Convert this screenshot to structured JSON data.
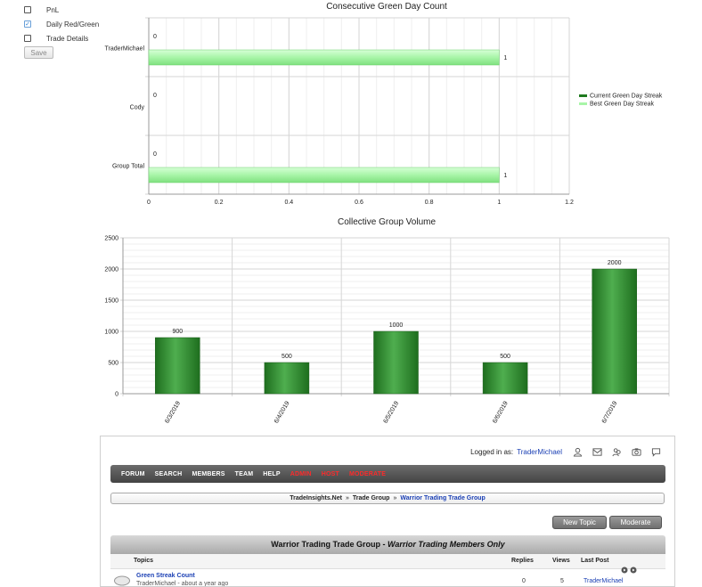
{
  "share_options": {
    "items": [
      {
        "label": "PnL",
        "checked": false
      },
      {
        "label": "Daily Red/Green",
        "checked": true
      },
      {
        "label": "Trade Details",
        "checked": false
      }
    ],
    "save_label": "Save"
  },
  "chart_data": [
    {
      "type": "bar",
      "orientation": "horizontal",
      "title": "Consecutive Green Day Count",
      "categories": [
        "TraderMichael",
        "Cody",
        "Group Total"
      ],
      "series": [
        {
          "name": "Current Green Day Streak",
          "values": [
            0,
            0,
            0
          ],
          "color": "#1f7a1f"
        },
        {
          "name": "Best Green Day Streak",
          "values": [
            1,
            0,
            1
          ],
          "color": "#a8f5a8"
        }
      ],
      "current_labels": [
        "0",
        "0",
        "0"
      ],
      "best_labels": [
        "1",
        "",
        "1"
      ],
      "xlim": [
        0,
        1.2
      ],
      "xticks": [
        "0",
        "0.2",
        "0.4",
        "0.6",
        "0.8",
        "1",
        "1.2"
      ],
      "grid": true,
      "legend": "right"
    },
    {
      "type": "bar",
      "title": "Collective Group Volume",
      "categories": [
        "6/3/2019",
        "6/4/2019",
        "6/5/2019",
        "6/6/2019",
        "6/7/2019"
      ],
      "values": [
        900,
        500,
        1000,
        500,
        2000
      ],
      "value_labels": [
        "900",
        "500",
        "1000",
        "500",
        "2000"
      ],
      "ylim": [
        0,
        2500
      ],
      "yticks": [
        "0",
        "500",
        "1000",
        "1500",
        "2000",
        "2500"
      ],
      "color": "#2e8b2e",
      "grid": true
    }
  ],
  "forum": {
    "logged_in_label": "Logged in as:",
    "username": "TraderMichael",
    "top_icons": [
      "user-icon",
      "mail-icon",
      "users-icon",
      "camera-icon",
      "chat-icon"
    ],
    "nav": [
      {
        "label": "FORUM",
        "highlight": false
      },
      {
        "label": "SEARCH",
        "highlight": false
      },
      {
        "label": "MEMBERS",
        "highlight": false
      },
      {
        "label": "TEAM",
        "highlight": false
      },
      {
        "label": "HELP",
        "highlight": false
      },
      {
        "label": "ADMIN",
        "highlight": true
      },
      {
        "label": "HOST",
        "highlight": true
      },
      {
        "label": "MODERATE",
        "highlight": true
      }
    ],
    "breadcrumb": [
      "TradeInsights.Net",
      "Trade Group",
      "Warrior Trading Trade Group"
    ],
    "breadcrumb_sep": "»",
    "new_topic_label": "New Topic",
    "moderate_label": "Moderate",
    "group_title": "Warrior Trading Trade Group",
    "group_subtitle": "Warrior Trading Members Only",
    "group_title_sep": " - ",
    "columns": {
      "topics": "Topics",
      "replies": "Replies",
      "views": "Views",
      "last_post": "Last Post"
    },
    "topics": [
      {
        "title": "Green Streak Count",
        "meta": "TraderMichael - about a year ago",
        "replies": "0",
        "views": "5",
        "last_post": "TraderMichael"
      }
    ]
  }
}
